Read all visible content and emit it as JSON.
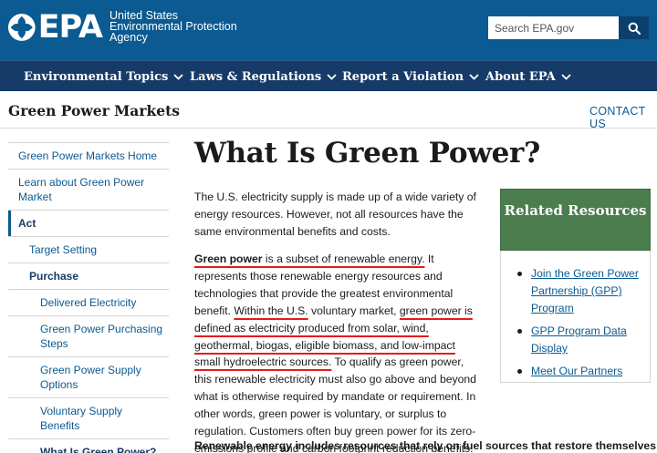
{
  "header": {
    "logo_text": "EPA",
    "agency_lines": [
      "United States",
      "Environmental Protection",
      "Agency"
    ],
    "search_placeholder": "Search EPA.gov"
  },
  "nav": [
    {
      "label": "Environmental Topics"
    },
    {
      "label": "Laws & Regulations"
    },
    {
      "label": "Report a Violation"
    },
    {
      "label": "About EPA"
    }
  ],
  "section": {
    "title": "Green Power Markets",
    "contact": "CONTACT US"
  },
  "sidebar": {
    "items": [
      {
        "label": "Green Power Markets Home"
      },
      {
        "label": "Learn about Green Power Market"
      },
      {
        "label": "Act"
      },
      {
        "label": "Target Setting"
      },
      {
        "label": "Purchase"
      },
      {
        "label": "Delivered Electricity"
      },
      {
        "label": "Green Power Purchasing Steps"
      },
      {
        "label": "Green Power Supply Options"
      },
      {
        "label": "Voluntary Supply Benefits"
      },
      {
        "label": "What Is Green Power?"
      }
    ]
  },
  "main": {
    "title": "What Is Green Power?",
    "p1": "The U.S. electricity supply is made up of a wide variety of energy resources. However, not all resources have the same environmental benefits and costs.",
    "p2": {
      "s1": "Green power",
      "s2": " is a subset of renewable energy.",
      "s3": " It represents those renewable energy resources and technologies that provide the greatest environmental benefit. ",
      "s4": "Within the U.S.",
      "s5": " voluntary market, ",
      "s6": "green power is defined as electricity produced from solar, wind, geothermal, biogas, eligible biomass, and low-impact small hydroelectric sources.",
      "s7": " To qualify as green power, this renewable electricity must also go above and beyond what is otherwise required by mandate or requirement. In other words, green power is voluntary, or surplus to regulation. Customers often buy green power for its zero-emissions profile and carbon footprint reduction benefits."
    },
    "p3": "Renewable energy includes resources that rely on fuel sources that restore themselves"
  },
  "related": {
    "title": "Related Resources",
    "links": [
      "Join the Green Power Partnership (GPP) Program",
      "GPP Program Data Display",
      "Meet Our Partners"
    ]
  },
  "colors": {
    "header_blue": "#0b5a91",
    "nav_navy": "#173b68",
    "related_green": "#4b7d4f",
    "annotation_red": "#e31c1c"
  }
}
